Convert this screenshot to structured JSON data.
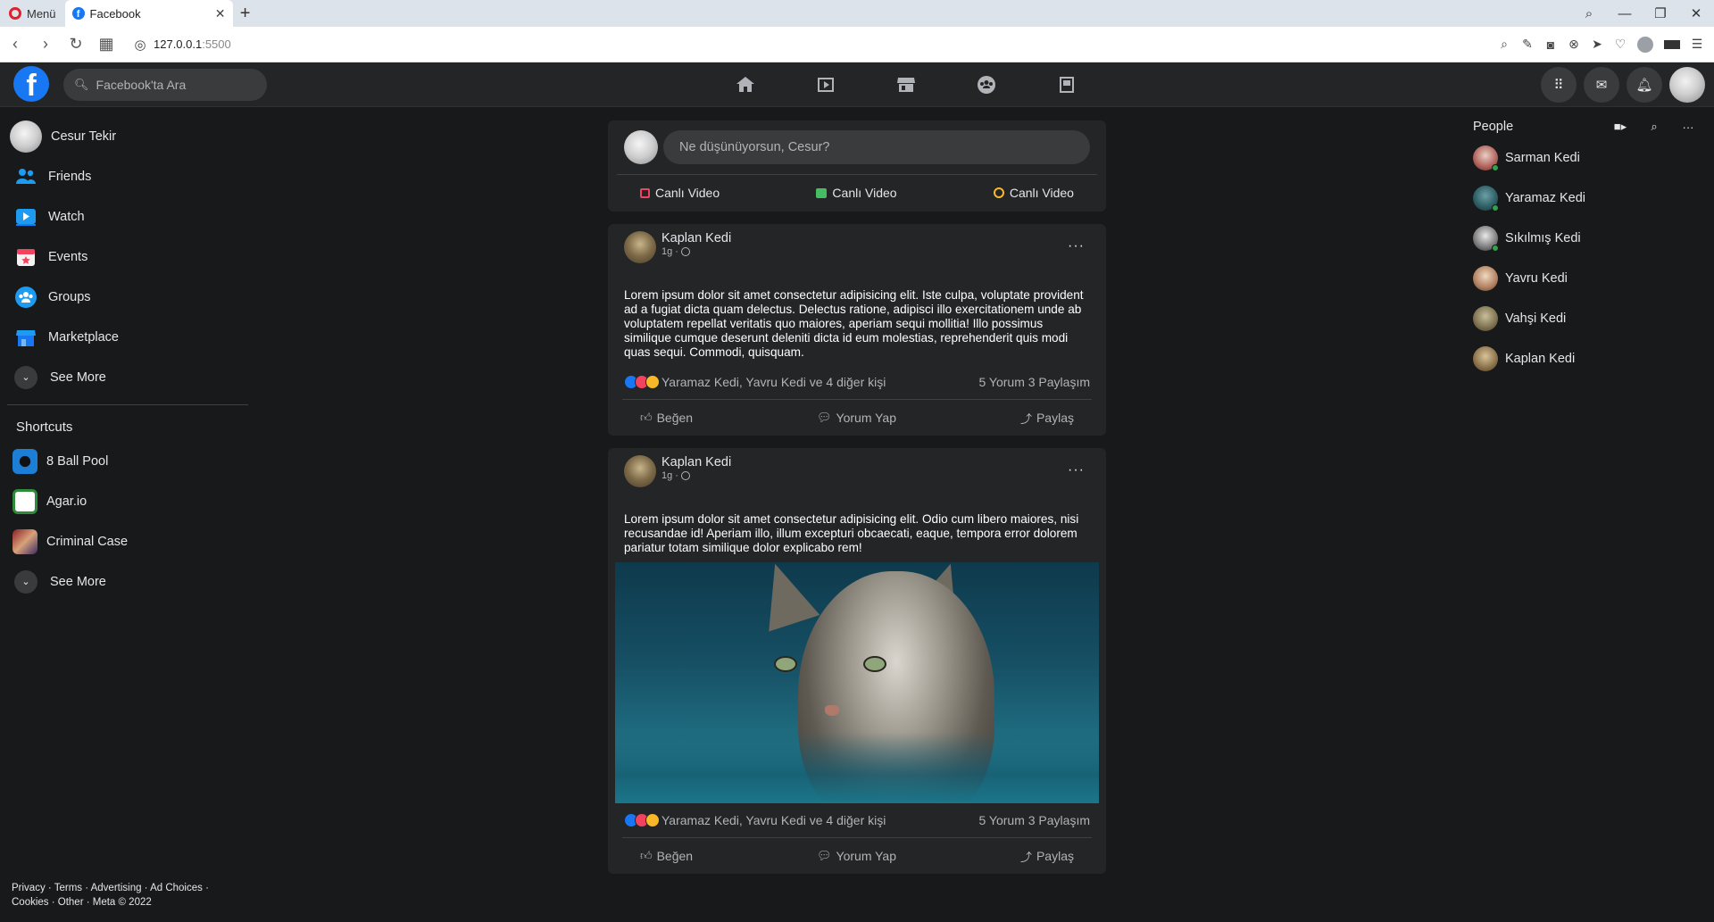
{
  "browser": {
    "menu_label": "Menü",
    "tab_title": "Facebook",
    "tab_close": "✕",
    "new_tab": "+",
    "url_host": "127.0.0.1",
    "url_port": ":5500"
  },
  "header": {
    "logo_letter": "f",
    "search_placeholder": "Facebook'ta Ara",
    "nav": [
      "home-icon",
      "watch-icon",
      "marketplace-icon",
      "groups-icon",
      "gaming-icon"
    ]
  },
  "sidebar": {
    "user_name": "Cesur Tekir",
    "items": [
      {
        "label": "Friends",
        "icon": "friends-icon"
      },
      {
        "label": "Watch",
        "icon": "watch-icon"
      },
      {
        "label": "Events",
        "icon": "events-icon"
      },
      {
        "label": "Groups",
        "icon": "groups-icon"
      },
      {
        "label": "Marketplace",
        "icon": "marketplace-icon"
      }
    ],
    "see_more": "See More",
    "shortcuts_title": "Shortcuts",
    "shortcuts": [
      {
        "label": "8 Ball Pool"
      },
      {
        "label": "Agar.io"
      },
      {
        "label": "Criminal Case"
      }
    ],
    "shortcuts_see_more": "See More"
  },
  "footer": {
    "line1": "Privacy · Terms · Advertising · Ad Choices ·",
    "line2": "Cookies · Other · Meta © 2022"
  },
  "composer": {
    "placeholder": "Ne düşünüyorsun, Cesur?",
    "actions": [
      "Canlı Video",
      "Canlı Video",
      "Canlı Video"
    ]
  },
  "posts": [
    {
      "author": "Kaplan Kedi",
      "time": "1g ·",
      "text": "Lorem ipsum dolor sit amet consectetur adipisicing elit. Iste culpa, voluptate provident ad a fugiat dicta quam delectus. Delectus ratione, adipisci illo exercitationem unde ab voluptatem repellat veritatis quo maiores, aperiam sequi mollitia! Illo possimus similique cumque deserunt deleniti dicta id eum molestias, reprehenderit quis modi quas sequi. Commodi, quisquam.",
      "reactions_text": "Yaramaz Kedi, Yavru Kedi ve 4 diğer kişi",
      "stats": "5 Yorum 3 Paylaşım",
      "like": "Beğen",
      "comment": "Yorum Yap",
      "share": "Paylaş"
    },
    {
      "author": "Kaplan Kedi",
      "time": "1g ·",
      "text": "Lorem ipsum dolor sit amet consectetur adipisicing elit. Odio cum libero maiores, nisi recusandae id! Aperiam illo, illum excepturi obcaecati, eaque, tempora error dolorem pariatur totam similique dolor explicabo rem!",
      "reactions_text": "Yaramaz Kedi, Yavru Kedi ve 4 diğer kişi",
      "stats": "5 Yorum 3 Paylaşım",
      "like": "Beğen",
      "comment": "Yorum Yap",
      "share": "Paylaş"
    }
  ],
  "people": {
    "title": "People",
    "contacts": [
      {
        "name": "Sarman Kedi",
        "online": true
      },
      {
        "name": "Yaramaz Kedi",
        "online": true
      },
      {
        "name": "Sıkılmış Kedi",
        "online": true
      },
      {
        "name": "Yavru Kedi",
        "online": false
      },
      {
        "name": "Vahşi Kedi",
        "online": false
      },
      {
        "name": "Kaplan Kedi",
        "online": false
      }
    ]
  },
  "colors": {
    "background": "#18191a",
    "card": "#242526",
    "accent": "#1877f2",
    "online": "#31a24c"
  }
}
